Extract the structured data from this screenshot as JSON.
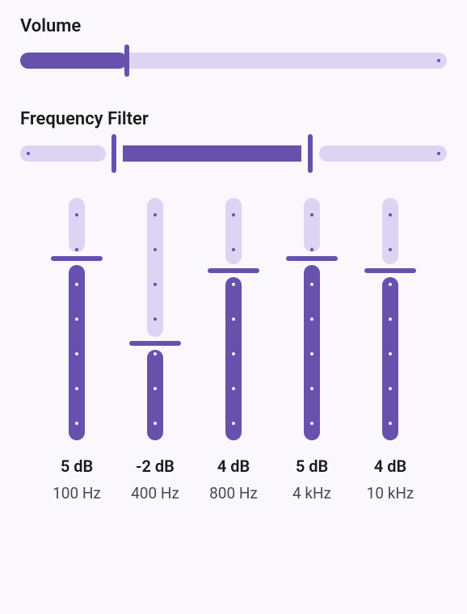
{
  "volume": {
    "label": "Volume",
    "value": 25,
    "min": 0,
    "max": 100
  },
  "frequency_filter": {
    "label": "Frequency Filter",
    "low": 22,
    "high": 68,
    "min": 0,
    "max": 100
  },
  "eq": {
    "min_db": -10,
    "max_db": 10,
    "bands": [
      {
        "db_label": "5 dB",
        "freq_label": "100 Hz",
        "db": 5
      },
      {
        "db_label": "-2 dB",
        "freq_label": "400 Hz",
        "db": -2
      },
      {
        "db_label": "4 dB",
        "freq_label": "800 Hz",
        "db": 4
      },
      {
        "db_label": "5 dB",
        "freq_label": "4 kHz",
        "db": 5
      },
      {
        "db_label": "4 dB",
        "freq_label": "10 kHz",
        "db": 4
      }
    ]
  },
  "colors": {
    "accent": "#6751ad",
    "track": "#dcd4f3",
    "bg": "#fbf8fd"
  }
}
